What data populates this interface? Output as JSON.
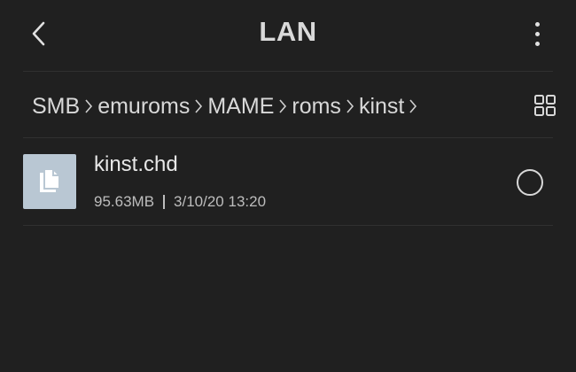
{
  "header": {
    "title": "LAN",
    "back_icon": "chevron-left-icon",
    "more_icon": "more-vertical-icon"
  },
  "breadcrumb": {
    "items": [
      "SMB",
      "emuroms",
      "MAME",
      "roms",
      "kinst"
    ],
    "separator_icon": "chevron-right-icon"
  },
  "view_toggle_icon": "grid-view-icon",
  "files": [
    {
      "name": "kinst.chd",
      "size": "95.63MB",
      "date": "3/10/20 13:20",
      "icon": "file-copy-icon",
      "selected": false
    }
  ],
  "colors": {
    "background": "#202020",
    "text": "#e6e6e6",
    "thumb": "#b9c7d3"
  }
}
